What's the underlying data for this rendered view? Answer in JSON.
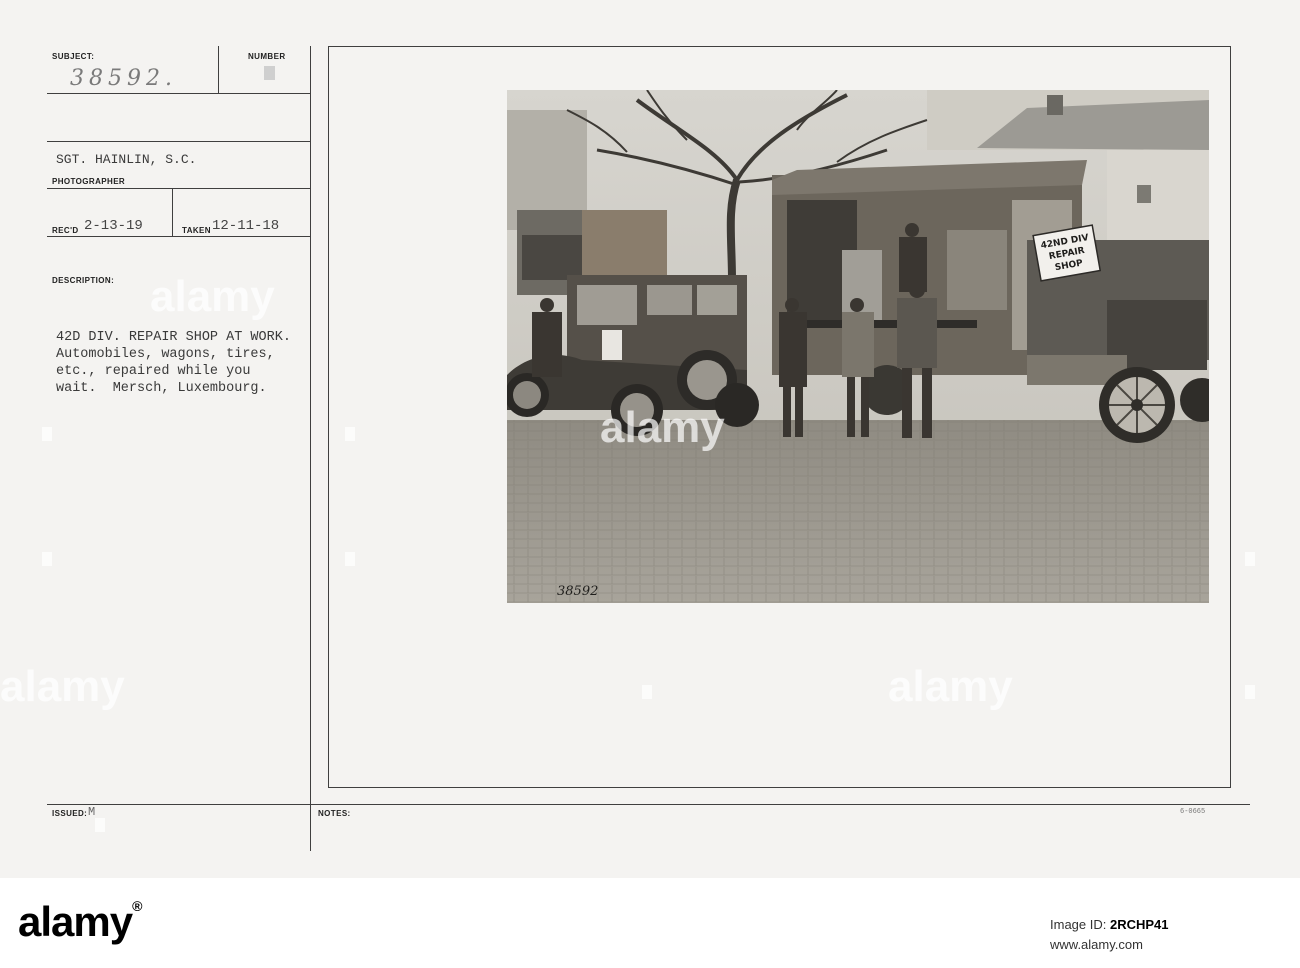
{
  "card": {
    "subject_label": "SUBJECT:",
    "subject_number": "38592.",
    "number_label": "NUMBER",
    "photographer_name": "SGT. HAINLIN, S.C.",
    "photographer_label": "PHOTOGRAPHER",
    "recd_label": "REC'D",
    "recd_date": "2-13-19",
    "taken_label": "TAKEN",
    "taken_date": "12-11-18",
    "description_label": "DESCRIPTION:",
    "description_lines": [
      "42D DIV. REPAIR SHOP AT WORK.",
      "Automobiles, wagons, tires,",
      "etc., repaired while you",
      "wait.  Mersch, Luxembourg."
    ],
    "issued_label": "ISSUED:",
    "issued_value": "M",
    "notes_label": "NOTES:",
    "corner_code": "6-0665"
  },
  "photo": {
    "sign_lines": [
      "42ND DIV",
      "REPAIR",
      "SHOP"
    ],
    "negative_number": "38592"
  },
  "watermark": {
    "text": "alamy"
  },
  "footer": {
    "brand": "alamy",
    "image_id_label": "Image ID:",
    "image_id": "2RCHP41",
    "site": "www.alamy.com"
  }
}
